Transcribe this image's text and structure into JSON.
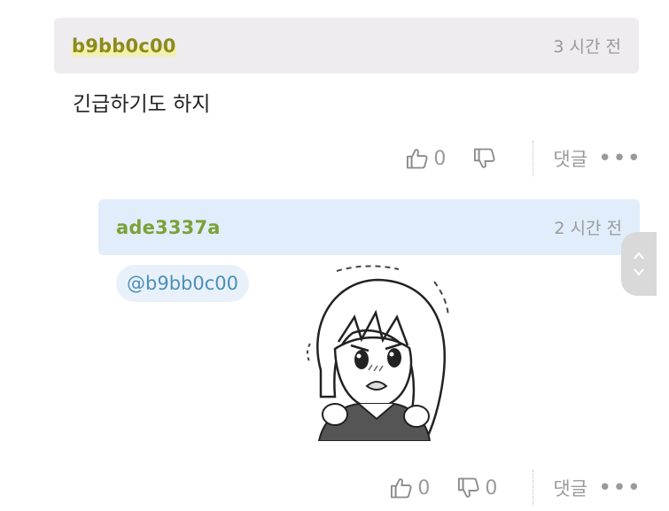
{
  "comments": [
    {
      "username": "b9bb0c00",
      "time": "3 시간 전",
      "text": "긴급하기도 하지",
      "likes": "0",
      "reply_label": "댓글",
      "more_label": "•••"
    },
    {
      "username": "ade3337a",
      "time": "2 시간 전",
      "mention": "@b9bb0c00",
      "likes": "0",
      "dislikes": "0",
      "reply_label": "댓글",
      "more_label": "•••"
    }
  ],
  "colors": {
    "comment1_header_bg": "#eeecee",
    "comment2_header_bg": "#e1edfa",
    "username1": "#8c8c1a",
    "username2": "#7aa238",
    "mention": "#4a8fb8"
  }
}
